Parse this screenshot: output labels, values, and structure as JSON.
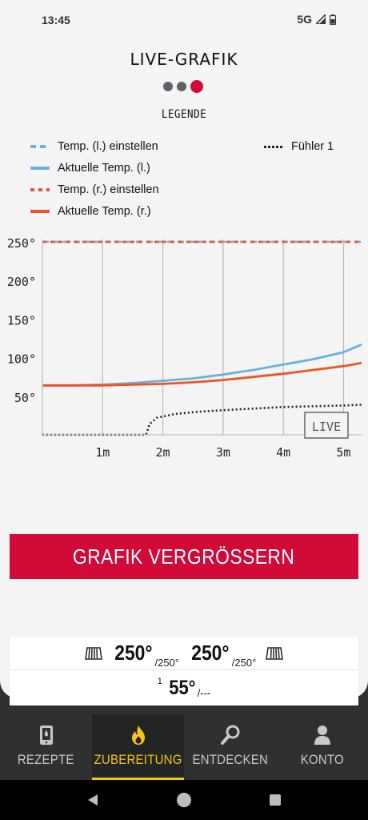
{
  "status": {
    "time": "13:45",
    "network": "5G"
  },
  "header": {
    "title": "LIVE-GRAFIK",
    "legend_title": "LEGENDE"
  },
  "pagination": {
    "count": 3,
    "active": 3
  },
  "legend": [
    {
      "label": "Temp. (l.) einstellen",
      "style": "dashed",
      "color": "#68b1df"
    },
    {
      "label": "Aktuelle Temp. (l.)",
      "style": "solid",
      "color": "#68b1df"
    },
    {
      "label": "Temp. (r.) einstellen",
      "style": "dashed",
      "color": "#f05323"
    },
    {
      "label": "Aktuelle Temp. (r.)",
      "style": "solid",
      "color": "#f05323"
    },
    {
      "label": "Fühler 1",
      "style": "dotted",
      "color": "#222222"
    }
  ],
  "chart_data": {
    "type": "line",
    "x_unit": "minutes",
    "xlim": [
      0,
      5.3
    ],
    "ylim": [
      0,
      260
    ],
    "y_ticks": [
      {
        "v": 50,
        "label": "50°"
      },
      {
        "v": 100,
        "label": "100°"
      },
      {
        "v": 150,
        "label": "150°"
      },
      {
        "v": 200,
        "label": "200°"
      },
      {
        "v": 250,
        "label": "250°"
      }
    ],
    "x_ticks": [
      {
        "v": 1,
        "label": "1m"
      },
      {
        "v": 2,
        "label": "2m"
      },
      {
        "v": 3,
        "label": "3m"
      },
      {
        "v": 4,
        "label": "4m"
      },
      {
        "v": 5,
        "label": "5m"
      }
    ],
    "grid": "vertical",
    "live_label": "LIVE",
    "series": [
      {
        "name": "Temp. (l.) einstellen",
        "color": "#68b1df",
        "dash": "8 5",
        "x": [
          0,
          5.3
        ],
        "y": [
          250,
          250
        ]
      },
      {
        "name": "Temp. (r.) einstellen",
        "color": "#f05323",
        "dash": "5 5",
        "x": [
          0,
          5.3
        ],
        "y": [
          250,
          250
        ]
      },
      {
        "name": "Aktuelle Temp. (l.)",
        "color": "#68b1df",
        "dash": "",
        "x": [
          0,
          0.5,
          1.0,
          1.5,
          2.0,
          2.5,
          3.0,
          3.5,
          4.0,
          4.5,
          5.0,
          5.3
        ],
        "y": [
          64,
          64,
          65,
          67,
          70,
          73,
          78,
          84,
          91,
          98,
          107,
          117
        ]
      },
      {
        "name": "Aktuelle Temp. (r.)",
        "color": "#f05323",
        "dash": "",
        "x": [
          0,
          0.5,
          1.0,
          1.5,
          2.0,
          2.5,
          3.0,
          3.5,
          4.0,
          4.5,
          5.0,
          5.3
        ],
        "y": [
          64,
          64,
          64,
          65,
          66,
          68,
          71,
          75,
          79,
          84,
          89,
          93
        ]
      },
      {
        "name": "Fühler 1",
        "color": "#222222",
        "dash": "2 3",
        "x": [
          0,
          1.72,
          1.78,
          1.9,
          2.2,
          2.6,
          3.0,
          3.5,
          4.0,
          4.5,
          5.0,
          5.3
        ],
        "y": [
          0,
          0,
          14,
          22,
          27,
          30,
          32,
          34,
          36,
          37,
          38,
          39
        ]
      }
    ]
  },
  "actions": {
    "enlarge_label": "GRAFIK VERGRÖSSERN"
  },
  "grill_status": {
    "left_current": "250°",
    "left_set": "/250°",
    "right_current": "250°",
    "right_set": "/250°",
    "probe_number": "1",
    "probe_current": "55°",
    "probe_set": "/---"
  },
  "nav": [
    {
      "label": "REZEPTE",
      "icon": "phone-recipe-icon",
      "active": false
    },
    {
      "label": "ZUBEREITUNG",
      "icon": "flame-icon",
      "active": true
    },
    {
      "label": "ENTDECKEN",
      "icon": "magnifier-icon",
      "active": false
    },
    {
      "label": "KONTO",
      "icon": "person-icon",
      "active": false
    }
  ]
}
